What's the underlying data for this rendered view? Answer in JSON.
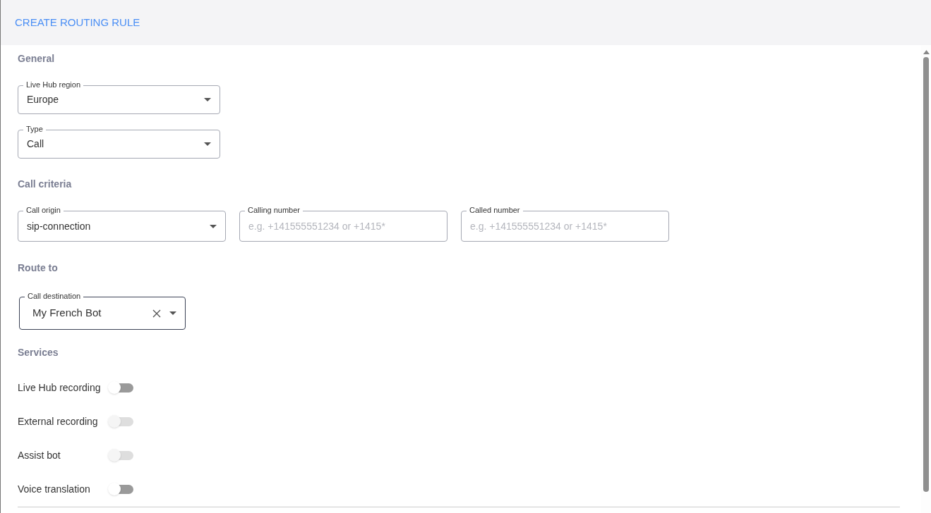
{
  "header": {
    "title": "CREATE ROUTING RULE"
  },
  "sections": [
    {
      "title": "General",
      "fields": [
        {
          "kind": "select",
          "label": "Live Hub region",
          "value": "Europe"
        },
        {
          "kind": "select",
          "label": "Type",
          "value": "Call"
        }
      ]
    },
    {
      "title": "Call criteria",
      "fields": [
        {
          "kind": "select",
          "label": "Call origin",
          "value": "sip-connection"
        },
        {
          "kind": "text",
          "label": "Calling number",
          "placeholder": "e.g. +141555551234 or +1415*"
        },
        {
          "kind": "text",
          "label": "Called number",
          "placeholder": "e.g. +141555551234 or +1415*"
        }
      ]
    },
    {
      "title": "Route to",
      "fields": [
        {
          "kind": "select",
          "label": "Call destination",
          "value": "My French Bot",
          "clearable": true
        }
      ]
    }
  ],
  "services": {
    "title": "Services",
    "toggles": [
      {
        "label": "Live Hub recording",
        "on": false,
        "disabled": false
      },
      {
        "label": "External recording",
        "on": false,
        "disabled": true
      },
      {
        "label": "Assist bot",
        "on": false,
        "disabled": true
      },
      {
        "label": "Voice translation",
        "on": false,
        "disabled": false
      }
    ]
  }
}
